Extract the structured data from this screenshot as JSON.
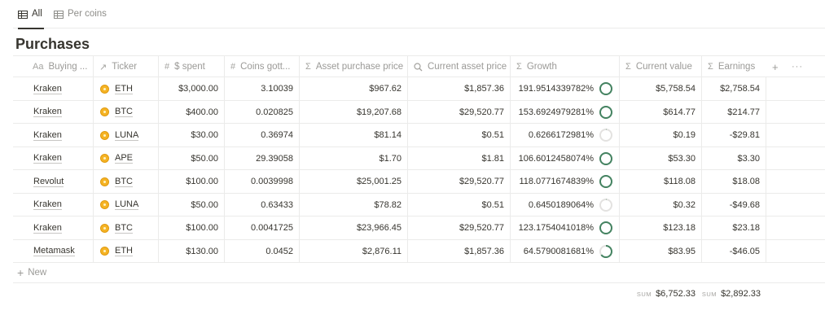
{
  "tabs": [
    {
      "label": "All",
      "icon": "table-icon",
      "active": true
    },
    {
      "label": "Per coins",
      "icon": "table-icon",
      "active": false
    }
  ],
  "title": "Purchases",
  "columns": [
    {
      "label": "Buying ...",
      "icon": "Aa"
    },
    {
      "label": "Ticker",
      "icon": "↗"
    },
    {
      "label": "$ spent",
      "icon": "#"
    },
    {
      "label": "Coins gott...",
      "icon": "#"
    },
    {
      "label": "Asset purchase price",
      "icon": "Σ"
    },
    {
      "label": "Current asset price",
      "icon": "search-icon"
    },
    {
      "label": "Growth",
      "icon": "Σ"
    },
    {
      "label": "Current value",
      "icon": "Σ"
    },
    {
      "label": "Earnings",
      "icon": "Σ"
    }
  ],
  "header_actions": {
    "add": "+",
    "more": "···"
  },
  "rows": [
    {
      "buying": "Kraken",
      "ticker": "ETH",
      "spent": "$3,000.00",
      "coins": "3.10039",
      "purchase_price": "$967.62",
      "current_price": "$1,857.36",
      "growth": "191.9514339782%",
      "growth_pct": 100,
      "current_value": "$5,758.54",
      "earnings": "$2,758.54"
    },
    {
      "buying": "Kraken",
      "ticker": "BTC",
      "spent": "$400.00",
      "coins": "0.020825",
      "purchase_price": "$19,207.68",
      "current_price": "$29,520.77",
      "growth": "153.6924979281%",
      "growth_pct": 100,
      "current_value": "$614.77",
      "earnings": "$214.77"
    },
    {
      "buying": "Kraken",
      "ticker": "LUNA",
      "spent": "$30.00",
      "coins": "0.36974",
      "purchase_price": "$81.14",
      "current_price": "$0.51",
      "growth": "0.6266172981%",
      "growth_pct": 0.63,
      "current_value": "$0.19",
      "earnings": "-$29.81"
    },
    {
      "buying": "Kraken",
      "ticker": "APE",
      "spent": "$50.00",
      "coins": "29.39058",
      "purchase_price": "$1.70",
      "current_price": "$1.81",
      "growth": "106.6012458074%",
      "growth_pct": 100,
      "current_value": "$53.30",
      "earnings": "$3.30"
    },
    {
      "buying": "Revolut",
      "ticker": "BTC",
      "spent": "$100.00",
      "coins": "0.0039998",
      "purchase_price": "$25,001.25",
      "current_price": "$29,520.77",
      "growth": "118.0771674839%",
      "growth_pct": 100,
      "current_value": "$118.08",
      "earnings": "$18.08"
    },
    {
      "buying": "Kraken",
      "ticker": "LUNA",
      "spent": "$50.00",
      "coins": "0.63433",
      "purchase_price": "$78.82",
      "current_price": "$0.51",
      "growth": "0.6450189064%",
      "growth_pct": 0.65,
      "current_value": "$0.32",
      "earnings": "-$49.68"
    },
    {
      "buying": "Kraken",
      "ticker": "BTC",
      "spent": "$100.00",
      "coins": "0.0041725",
      "purchase_price": "$23,966.45",
      "current_price": "$29,520.77",
      "growth": "123.1754041018%",
      "growth_pct": 100,
      "current_value": "$123.18",
      "earnings": "$23.18"
    },
    {
      "buying": "Metamask",
      "ticker": "ETH",
      "spent": "$130.00",
      "coins": "0.0452",
      "purchase_price": "$2,876.11",
      "current_price": "$1,857.36",
      "growth": "64.5790081681%",
      "growth_pct": 64.58,
      "current_value": "$83.95",
      "earnings": "-$46.05"
    }
  ],
  "new_label": "New",
  "footer": {
    "current_value_label": "SUM",
    "current_value_sum": "$6,752.33",
    "earnings_label": "SUM",
    "earnings_sum": "$2,892.33"
  },
  "colors": {
    "ring": "#448361",
    "ring_track": "#e3e2e0",
    "coin": "#f5b324"
  }
}
